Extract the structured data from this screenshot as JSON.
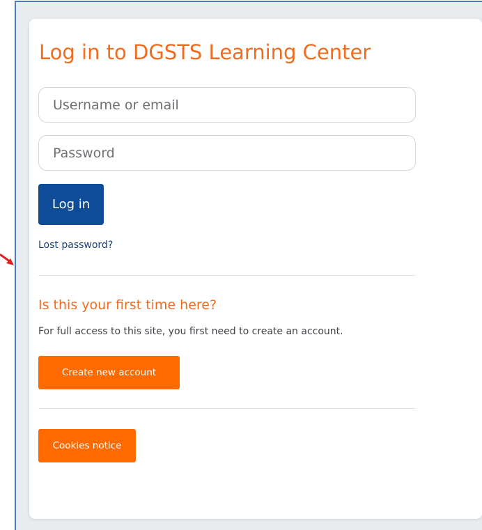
{
  "login": {
    "title": "Log in to DGSTS Learning Center",
    "username_placeholder": "Username or email",
    "password_placeholder": "Password",
    "login_button": "Log in",
    "lost_password": "Lost password?"
  },
  "signup": {
    "heading": "Is this your first time here?",
    "description": "For full access to this site, you first need to create an account.",
    "create_button": "Create new account"
  },
  "footer": {
    "cookies_button": "Cookies notice"
  },
  "colors": {
    "accent_orange": "#f26b1d",
    "button_orange": "#ff6a00",
    "primary_blue": "#0f4c97",
    "arrow_red": "#d9231c"
  },
  "icons": {
    "annotation_arrow": "red-arrow-icon"
  }
}
